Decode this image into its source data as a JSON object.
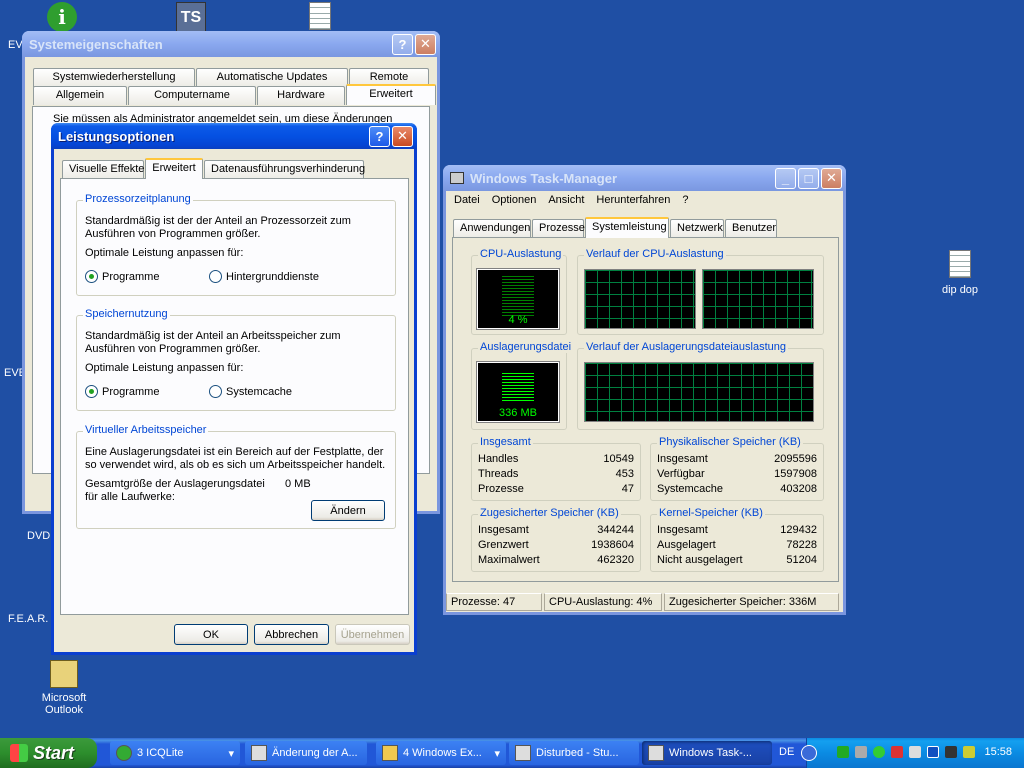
{
  "desktop": {
    "icons": [
      {
        "label": "dip dop"
      },
      {
        "label": "Microsoft Outlook"
      },
      {
        "label": "F.E.A.R."
      },
      {
        "label": "DVD"
      },
      {
        "label": "EVE"
      },
      {
        "label": "EVE"
      }
    ]
  },
  "sysprops": {
    "title": "Systemeigenschaften",
    "tabs_row1": [
      "Systemwiederherstellung",
      "Automatische Updates",
      "Remote"
    ],
    "tabs_row2": [
      "Allgemein",
      "Computername",
      "Hardware",
      "Erweitert"
    ],
    "admin_text": "Sie müssen als Administrator angemeldet sein, um diese Änderungen"
  },
  "perfopts": {
    "title": "Leistungsoptionen",
    "tabs": [
      "Visuelle Effekte",
      "Erweitert",
      "Datenausführungsverhinderung"
    ],
    "cpu_group": {
      "title": "Prozessorzeitplanung",
      "desc1": "Standardmäßig ist der der Anteil an Prozessorzeit zum",
      "desc2": "Ausführen von Programmen größer.",
      "adjust": "Optimale Leistung anpassen für:",
      "opt1": "Programme",
      "opt2": "Hintergrunddienste"
    },
    "mem_group": {
      "title": "Speichernutzung",
      "desc1": "Standardmäßig ist der Anteil an Arbeitsspeicher zum",
      "desc2": "Ausführen von Programmen größer.",
      "adjust": "Optimale Leistung anpassen für:",
      "opt1": "Programme",
      "opt2": "Systemcache"
    },
    "vm_group": {
      "title": "Virtueller Arbeitsspeicher",
      "desc1": "Eine Auslagerungsdatei ist ein Bereich auf der Festplatte, der",
      "desc2": "so verwendet wird, als ob es sich um Arbeitsspeicher handelt.",
      "size_label1": "Gesamtgröße der Auslagerungsdatei",
      "size_label2": "für alle Laufwerke:",
      "size_value": "0 MB",
      "change_button": "Ändern"
    },
    "ok": "OK",
    "cancel": "Abbrechen",
    "apply": "Übernehmen"
  },
  "taskmgr": {
    "title": "Windows Task-Manager",
    "menu": [
      "Datei",
      "Optionen",
      "Ansicht",
      "Herunterfahren",
      "?"
    ],
    "tabs": [
      "Anwendungen",
      "Prozesse",
      "Systemleistung",
      "Netzwerk",
      "Benutzer"
    ],
    "cpu_usage_label": "CPU-Auslastung",
    "cpu_usage_value": "4 %",
    "cpu_history_label": "Verlauf der CPU-Auslastung",
    "pagefile_label": "Auslagerungsdatei",
    "pagefile_value": "336 MB",
    "pagefile_history_label": "Verlauf der Auslagerungsdateiauslastung",
    "totals": {
      "title": "Insgesamt",
      "rows": [
        [
          "Handles",
          "10549"
        ],
        [
          "Threads",
          "453"
        ],
        [
          "Prozesse",
          "47"
        ]
      ]
    },
    "physical": {
      "title": "Physikalischer Speicher (KB)",
      "rows": [
        [
          "Insgesamt",
          "2095596"
        ],
        [
          "Verfügbar",
          "1597908"
        ],
        [
          "Systemcache",
          "403208"
        ]
      ]
    },
    "commit": {
      "title": "Zugesicherter Speicher (KB)",
      "rows": [
        [
          "Insgesamt",
          "344244"
        ],
        [
          "Grenzwert",
          "1938604"
        ],
        [
          "Maximalwert",
          "462320"
        ]
      ]
    },
    "kernel": {
      "title": "Kernel-Speicher (KB)",
      "rows": [
        [
          "Insgesamt",
          "129432"
        ],
        [
          "Ausgelagert",
          "78228"
        ],
        [
          "Nicht ausgelagert",
          "51204"
        ]
      ]
    },
    "status": [
      "Prozesse: 47",
      "CPU-Auslastung: 4%",
      "Zugesicherter Speicher: 336M"
    ]
  },
  "taskbar": {
    "start": "Start",
    "tasks": [
      "3 ICQLite",
      "Änderung der A...",
      "4 Windows Ex...",
      "Disturbed - Stu...",
      "Windows Task-..."
    ],
    "lang": "DE",
    "clock": "15:58"
  }
}
